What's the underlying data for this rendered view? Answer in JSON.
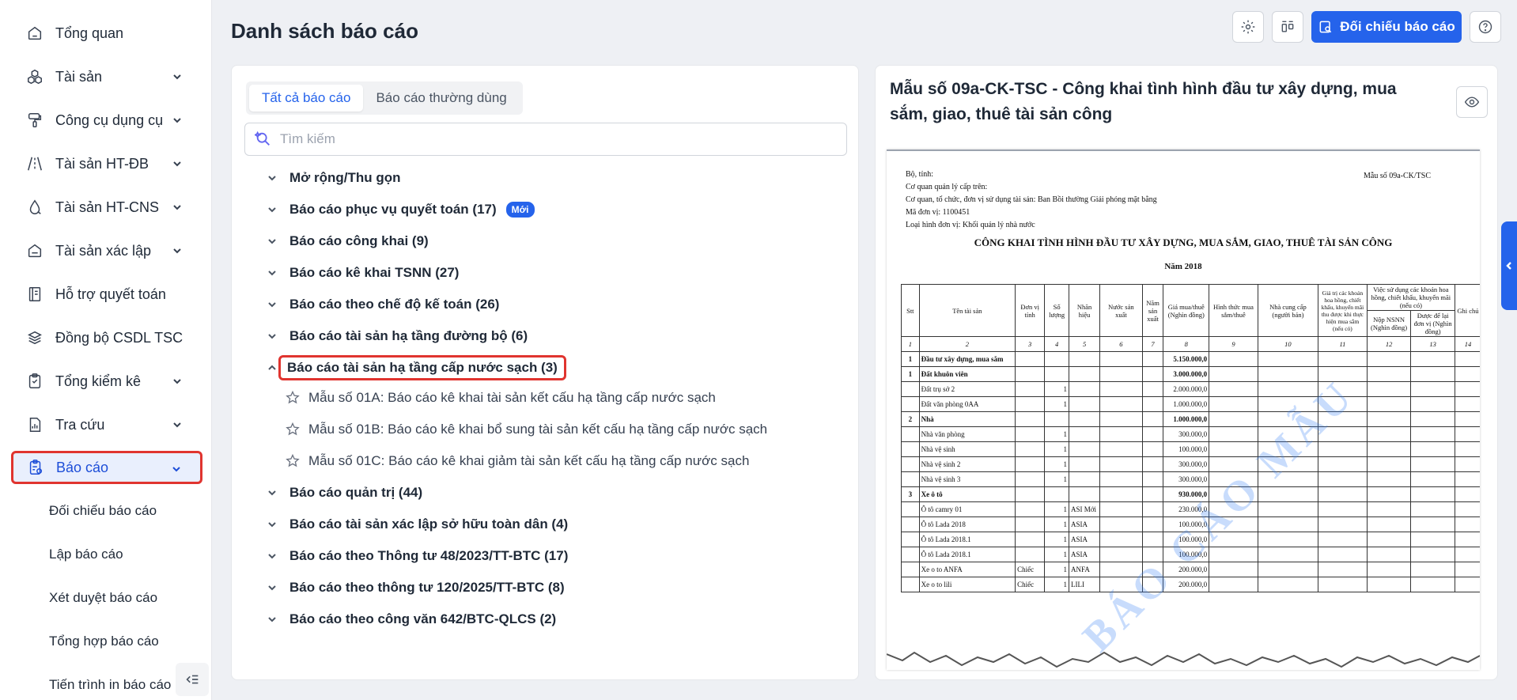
{
  "sidebar": {
    "items": [
      {
        "label": "Tổng quan",
        "icon": "home-icon",
        "has_children": false
      },
      {
        "label": "Tài sản",
        "icon": "assets-icon",
        "has_children": true
      },
      {
        "label": "Công cụ dụng cụ",
        "icon": "tools-icon",
        "has_children": true
      },
      {
        "label": "Tài sản HT-ĐB",
        "icon": "road-icon",
        "has_children": true
      },
      {
        "label": "Tài sản HT-CNS",
        "icon": "water-drop-icon",
        "has_children": true
      },
      {
        "label": "Tài sản xác lập",
        "icon": "house-icon",
        "has_children": true
      },
      {
        "label": "Hỗ trợ quyết toán",
        "icon": "book-icon",
        "has_children": false
      },
      {
        "label": "Đồng bộ CSDL TSC",
        "icon": "layers-sync-icon",
        "has_children": false
      },
      {
        "label": "Tổng kiểm kê",
        "icon": "clipboard-icon",
        "has_children": true
      },
      {
        "label": "Tra cứu",
        "icon": "chart-file-icon",
        "has_children": true
      },
      {
        "label": "Báo cáo",
        "icon": "report-icon",
        "has_children": true,
        "active": true
      }
    ],
    "sub_items": [
      "Đối chiếu báo cáo",
      "Lập báo cáo",
      "Xét duyệt báo cáo",
      "Tổng hợp báo cáo",
      "Tiến trình in báo cáo"
    ]
  },
  "header": {
    "title": "Danh sách báo cáo",
    "compare_button": "Đối chiếu báo cáo"
  },
  "left_panel": {
    "tabs": [
      "Tất cả báo cáo",
      "Báo cáo thường dùng"
    ],
    "selected_tab": 0,
    "search_placeholder": "Tìm kiếm",
    "tree": [
      {
        "label": "Mở rộng/Thu gọn"
      },
      {
        "label": "Báo cáo phục vụ quyết toán (17)",
        "badge": "Mới"
      },
      {
        "label": "Báo cáo công khai (9)"
      },
      {
        "label": "Báo cáo kê khai TSNN (27)"
      },
      {
        "label": "Báo cáo theo chế độ kế toán (26)"
      },
      {
        "label": "Báo cáo tài sản hạ tầng đường bộ (6)"
      },
      {
        "label": "Báo cáo tài sản hạ tầng cấp nước sạch (3)",
        "expanded": true,
        "children": [
          "Mẫu số 01A: Báo cáo kê khai tài sản kết cấu hạ tầng cấp nước sạch",
          "Mẫu số 01B: Báo cáo kê khai bổ sung tài sản kết cấu hạ tầng cấp nước sạch",
          "Mẫu số 01C: Báo cáo kê khai giảm tài sản kết cấu hạ tầng cấp nước sạch"
        ]
      },
      {
        "label": "Báo cáo quản trị (44)"
      },
      {
        "label": "Báo cáo tài sản xác lập sở hữu toàn dân (4)"
      },
      {
        "label": "Báo cáo theo Thông tư 48/2023/TT-BTC (17)"
      },
      {
        "label": "Báo cáo theo thông tư 120/2025/TT-BTC (8)"
      },
      {
        "label": "Báo cáo theo công văn 642/BTC-QLCS (2)"
      }
    ]
  },
  "preview": {
    "title": "Mẫu số 09a-CK-TSC - Công khai tình hình đầu tư xây dựng, mua sắm, giao, thuê tài sản công",
    "doc": {
      "meta": [
        "Bộ, tỉnh:",
        "Cơ quan quản lý cấp trên:",
        "Cơ quan, tổ chức, đơn vị sử dụng tài sản: Ban Bồi thường Giải phóng mặt bằng",
        "Mã đơn vị: 1100451",
        "Loại hình đơn vị: Khối quản lý nhà nước"
      ],
      "form_no": "Mẫu số 09a-CK/TSC",
      "title": "CÔNG KHAI TÌNH HÌNH ĐẦU TƯ XÂY DỰNG, MUA SẮM, GIAO, THUÊ TÀI SẢN CÔNG",
      "year": "Năm 2018",
      "watermark": "BÁO CÁO MẪU",
      "headers": {
        "stt": "Stt",
        "ten": "Tên tài sản",
        "dvt": "Đơn vị tính",
        "sl": "Số lượng",
        "nhan": "Nhãn hiệu",
        "nuoc": "Nước sản xuất",
        "nam": "Năm sản xuất",
        "gia": "Giá mua/thuê (Nghìn đồng)",
        "hinh": "Hình thức mua sắm/thuê",
        "ncc": "Nhà cung cấp (người bán)",
        "gtkm": "Giá trị các khoản hoa hồng, chiết khấu, khuyến mãi thu được khi thực hiện mua sắm (nếu có)",
        "vsd": "Việc sử dụng các khoản hoa hồng, chiết khấu, khuyến mãi (nếu có)",
        "nop": "Nộp NSNN (Nghìn đồng)",
        "dtl": "Được để lại đơn vị (Nghìn đồng)",
        "ghi": "Ghi chú"
      },
      "col_numbers": [
        "1",
        "2",
        "3",
        "4",
        "5",
        "6",
        "7",
        "8",
        "9",
        "10",
        "11",
        "12",
        "13",
        "14"
      ],
      "rows": [
        {
          "stt": "1",
          "name": "Đầu tư xây dựng, mua sắm",
          "unit": "",
          "qty": "",
          "brand": "",
          "price": "5.150.000,0",
          "bold": true
        },
        {
          "stt": "1",
          "name": "Đất khuôn viên",
          "unit": "",
          "qty": "",
          "brand": "",
          "price": "3.000.000,0",
          "bold": true
        },
        {
          "stt": "",
          "name": "Đất trụ sở 2",
          "unit": "",
          "qty": "1",
          "brand": "",
          "price": "2.000.000,0"
        },
        {
          "stt": "",
          "name": "Đất văn phòng 0AA",
          "unit": "",
          "qty": "1",
          "brand": "",
          "price": "1.000.000,0"
        },
        {
          "stt": "2",
          "name": "Nhà",
          "unit": "",
          "qty": "",
          "brand": "",
          "price": "1.000.000,0",
          "bold": true
        },
        {
          "stt": "",
          "name": "Nhà văn phòng",
          "unit": "",
          "qty": "1",
          "brand": "",
          "price": "300.000,0"
        },
        {
          "stt": "",
          "name": "Nhà vệ sinh",
          "unit": "",
          "qty": "1",
          "brand": "",
          "price": "100.000,0"
        },
        {
          "stt": "",
          "name": "Nhà vệ sinh 2",
          "unit": "",
          "qty": "1",
          "brand": "",
          "price": "300.000,0"
        },
        {
          "stt": "",
          "name": "Nhà vệ sinh 3",
          "unit": "",
          "qty": "1",
          "brand": "",
          "price": "300.000,0"
        },
        {
          "stt": "3",
          "name": "Xe ô tô",
          "unit": "",
          "qty": "",
          "brand": "",
          "price": "930.000,0",
          "bold": true
        },
        {
          "stt": "",
          "name": "Ô tô camry 01",
          "unit": "",
          "qty": "1",
          "brand": "ASI Mới",
          "price": "230.000,0"
        },
        {
          "stt": "",
          "name": "Ô tô Lada 2018",
          "unit": "",
          "qty": "1",
          "brand": "ASIA",
          "price": "100.000,0"
        },
        {
          "stt": "",
          "name": "Ô tô Lada 2018.1",
          "unit": "",
          "qty": "1",
          "brand": "ASIA",
          "price": "100.000,0"
        },
        {
          "stt": "",
          "name": "Ô tô Lada 2018.1",
          "unit": "",
          "qty": "1",
          "brand": "ASIA",
          "price": "100.000,0"
        },
        {
          "stt": "",
          "name": "Xe o to ANFA",
          "unit": "Chiếc",
          "qty": "1",
          "brand": "ANFA",
          "price": "200.000,0"
        },
        {
          "stt": "",
          "name": "Xe o to lili",
          "unit": "Chiếc",
          "qty": "1",
          "brand": "LILI",
          "price": "200.000,0"
        }
      ]
    }
  },
  "colors": {
    "primary": "#2563eb",
    "highlight_border": "#e0342f",
    "active_bg": "#e9effd"
  }
}
